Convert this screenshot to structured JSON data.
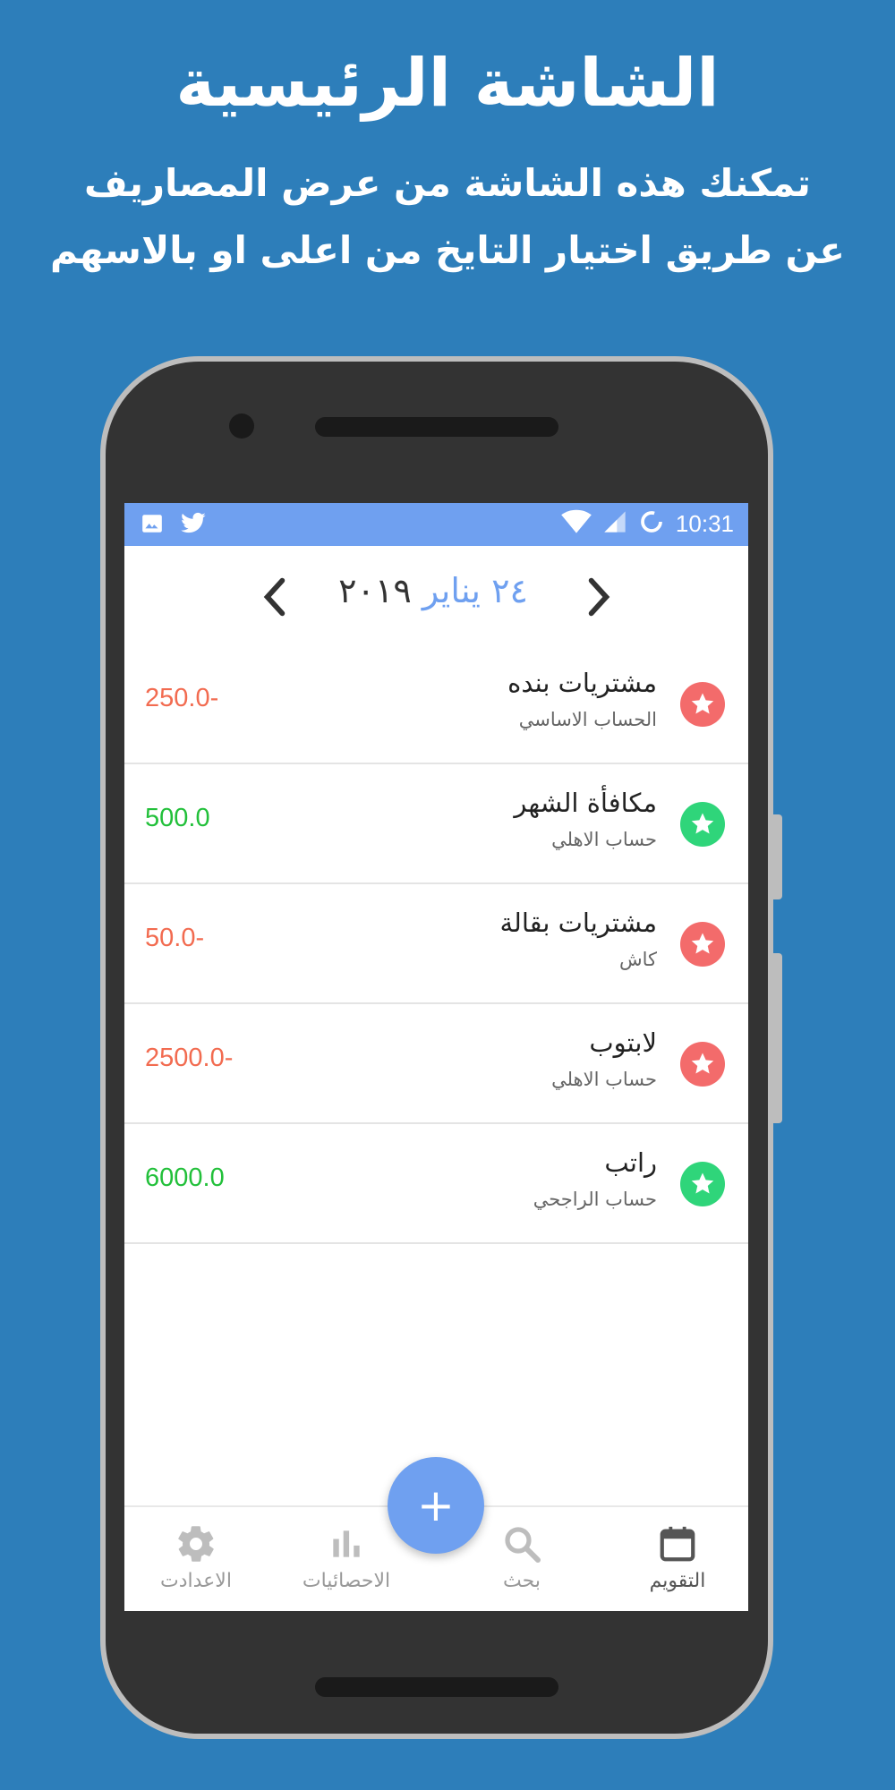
{
  "promo": {
    "title": "الشاشة الرئيسية",
    "line1": "تمكنك هذه الشاشة من عرض المصاريف",
    "line2": "عن طريق اختيار التايخ من اعلى او بالاسهم"
  },
  "statusbar": {
    "time": "10:31",
    "left_icons": [
      "image-icon",
      "twitter-icon"
    ],
    "right_icons": [
      "wifi-icon",
      "signal-icon",
      "sync-icon"
    ]
  },
  "date_nav": {
    "day_month": "٢٤ يناير",
    "year": "٢٠١٩"
  },
  "transactions": [
    {
      "title": "مشتريات بنده",
      "account": "الحساب الاساسي",
      "amount": "250.0-",
      "type": "expense"
    },
    {
      "title": "مكافأة الشهر",
      "account": "حساب الاهلي",
      "amount": "500.0",
      "type": "income"
    },
    {
      "title": "مشتريات بقالة",
      "account": "كاش",
      "amount": "50.0-",
      "type": "expense"
    },
    {
      "title": "لابتوب",
      "account": "حساب الاهلي",
      "amount": "2500.0-",
      "type": "expense"
    },
    {
      "title": "راتب",
      "account": "حساب الراجحي",
      "amount": "6000.0",
      "type": "income"
    }
  ],
  "fab": {
    "label": "+"
  },
  "bottom_nav": {
    "settings": "الاعدادت",
    "stats": "الاحصائيات",
    "search": "بحث",
    "calendar": "التقويم"
  },
  "colors": {
    "background": "#2d7eba",
    "accent": "#6fa0f0",
    "expense": "#f26b50",
    "income": "#22c03a",
    "expense_star": "#f36b6b",
    "income_star": "#2fd57a"
  }
}
